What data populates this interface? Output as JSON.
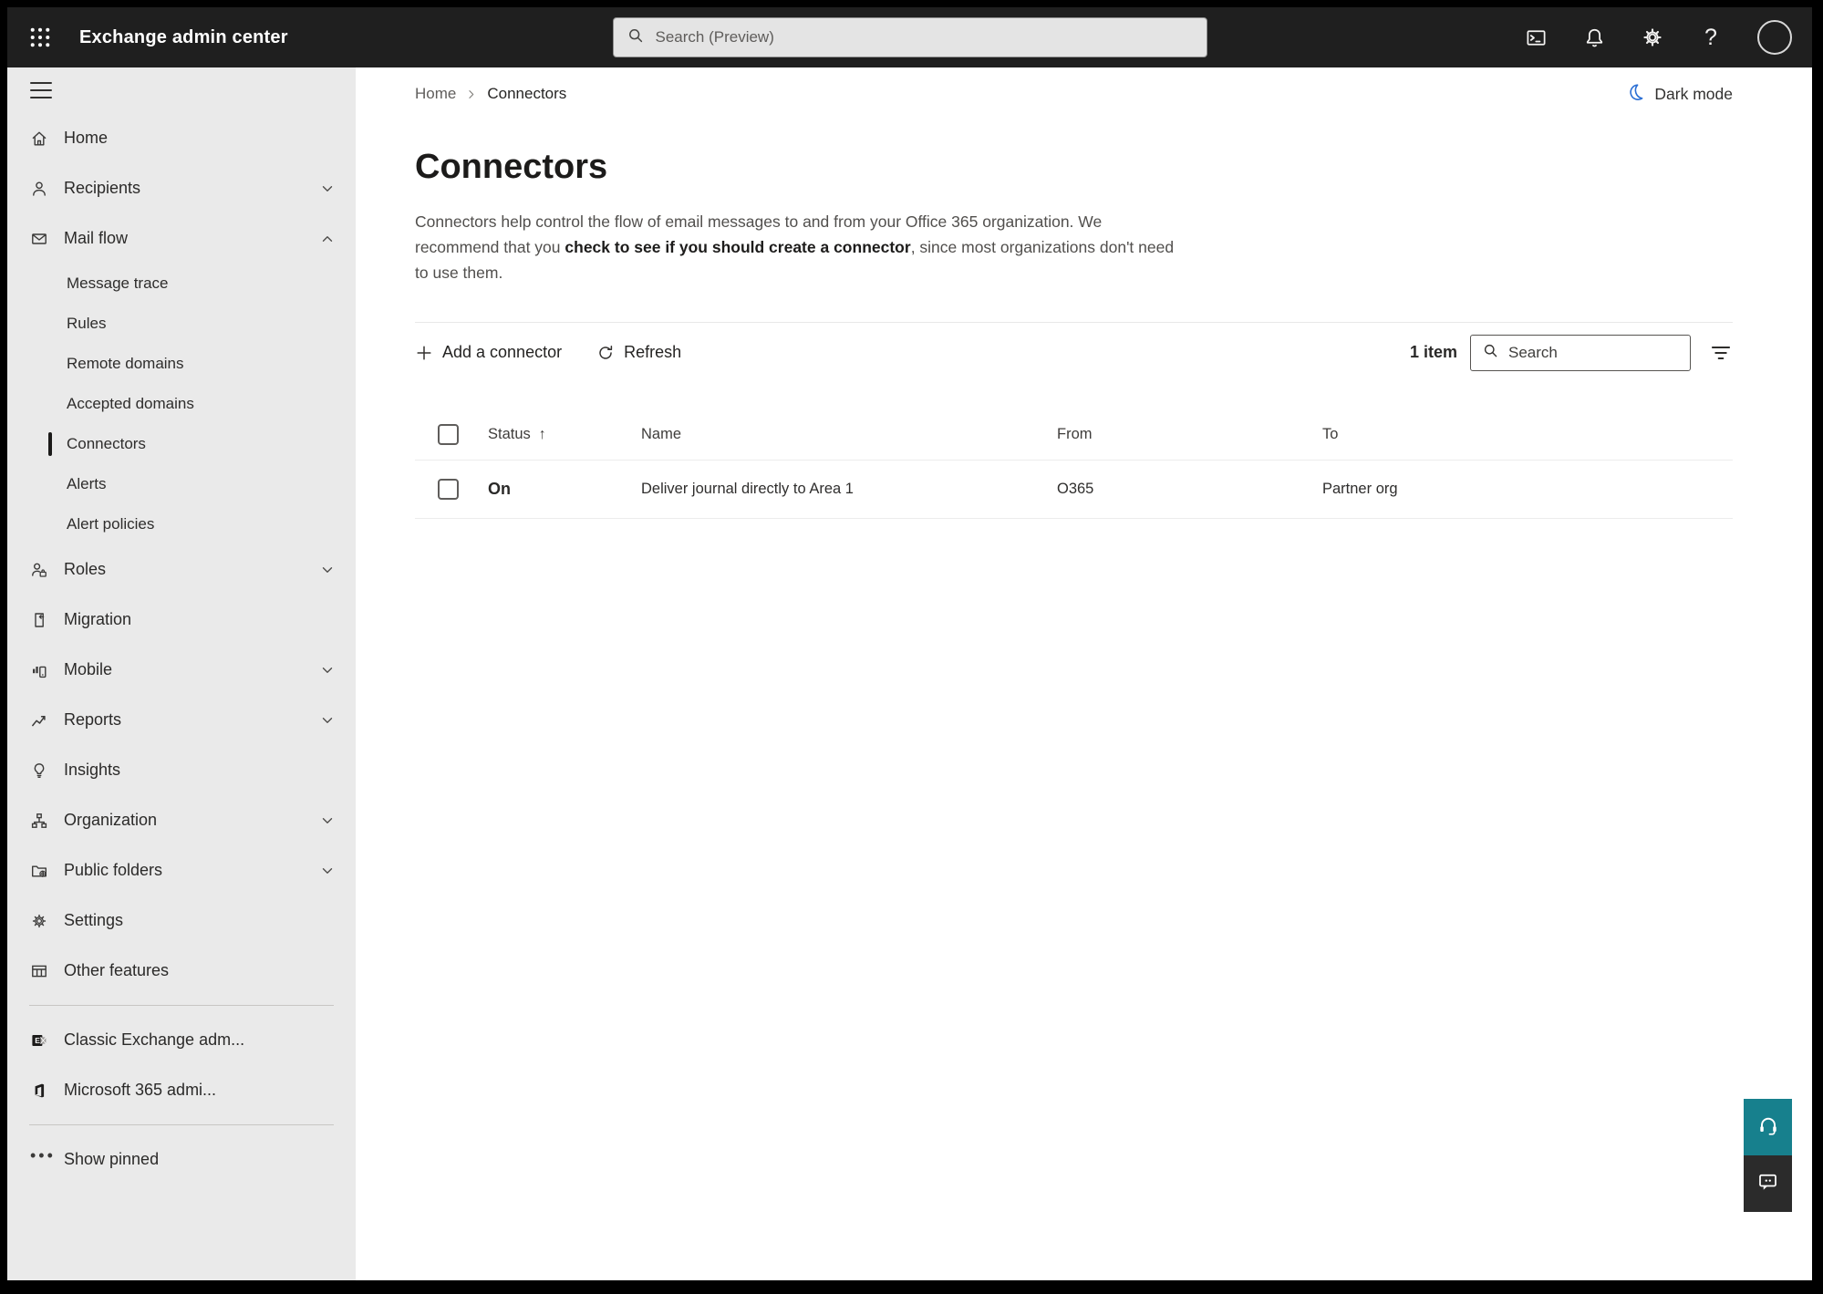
{
  "topbar": {
    "title": "Exchange admin center",
    "search_placeholder": "Search (Preview)"
  },
  "sidebar": {
    "items": [
      {
        "label": "Home"
      },
      {
        "label": "Recipients",
        "state": "collapsed"
      },
      {
        "label": "Mail flow",
        "state": "expanded"
      },
      {
        "label": "Message trace",
        "sub": true
      },
      {
        "label": "Rules",
        "sub": true
      },
      {
        "label": "Remote domains",
        "sub": true
      },
      {
        "label": "Accepted domains",
        "sub": true
      },
      {
        "label": "Connectors",
        "sub": true,
        "selected": true
      },
      {
        "label": "Alerts",
        "sub": true
      },
      {
        "label": "Alert policies",
        "sub": true
      },
      {
        "label": "Roles",
        "state": "collapsed"
      },
      {
        "label": "Migration"
      },
      {
        "label": "Mobile",
        "state": "collapsed"
      },
      {
        "label": "Reports",
        "state": "collapsed"
      },
      {
        "label": "Insights"
      },
      {
        "label": "Organization",
        "state": "collapsed"
      },
      {
        "label": "Public folders",
        "state": "collapsed"
      },
      {
        "label": "Settings"
      },
      {
        "label": "Other features"
      },
      {
        "label": "Classic Exchange adm..."
      },
      {
        "label": "Microsoft 365 admi..."
      },
      {
        "label": "Show pinned"
      }
    ]
  },
  "breadcrumb": {
    "home": "Home",
    "current": "Connectors"
  },
  "darkmode_label": "Dark mode",
  "page": {
    "title": "Connectors",
    "description_1": "Connectors help control the flow of email messages to and from your Office 365 organization. We recommend that you ",
    "description_link": "check to see if you should create a connector",
    "description_2": ", since most organizations don't need to use them."
  },
  "toolbar": {
    "add_label": "Add a connector",
    "refresh_label": "Refresh",
    "count": "1 item",
    "search_placeholder": "Search"
  },
  "table": {
    "sort_arrow": "↑",
    "headers": {
      "status": "Status",
      "name": "Name",
      "from": "From",
      "to": "To"
    },
    "rows": [
      {
        "status": "On",
        "name": "Deliver journal directly to Area 1",
        "from": "O365",
        "to": "Partner org"
      }
    ]
  },
  "icons": {
    "app_launcher": "waffle-grid-dots",
    "top_search": "magnifier",
    "cloud_shell": "terminal-window",
    "notifications": "bell",
    "settings_top": "gear",
    "help": "question-mark",
    "account": "avatar-circle",
    "dark_mode": "crescent-moon",
    "add": "plus",
    "refresh": "circular-arrow",
    "filter": "filter-lines",
    "support": "headset",
    "feedback": "chat-bubble"
  },
  "colors": {
    "topbar_bg": "#1f1f1f",
    "sidebar_bg": "#eaeaea",
    "accent_teal": "#17808d",
    "chat_btn": "#2b2b2b",
    "moon_blue": "#2b6fd4",
    "selected_bar": "#1b1a19"
  }
}
